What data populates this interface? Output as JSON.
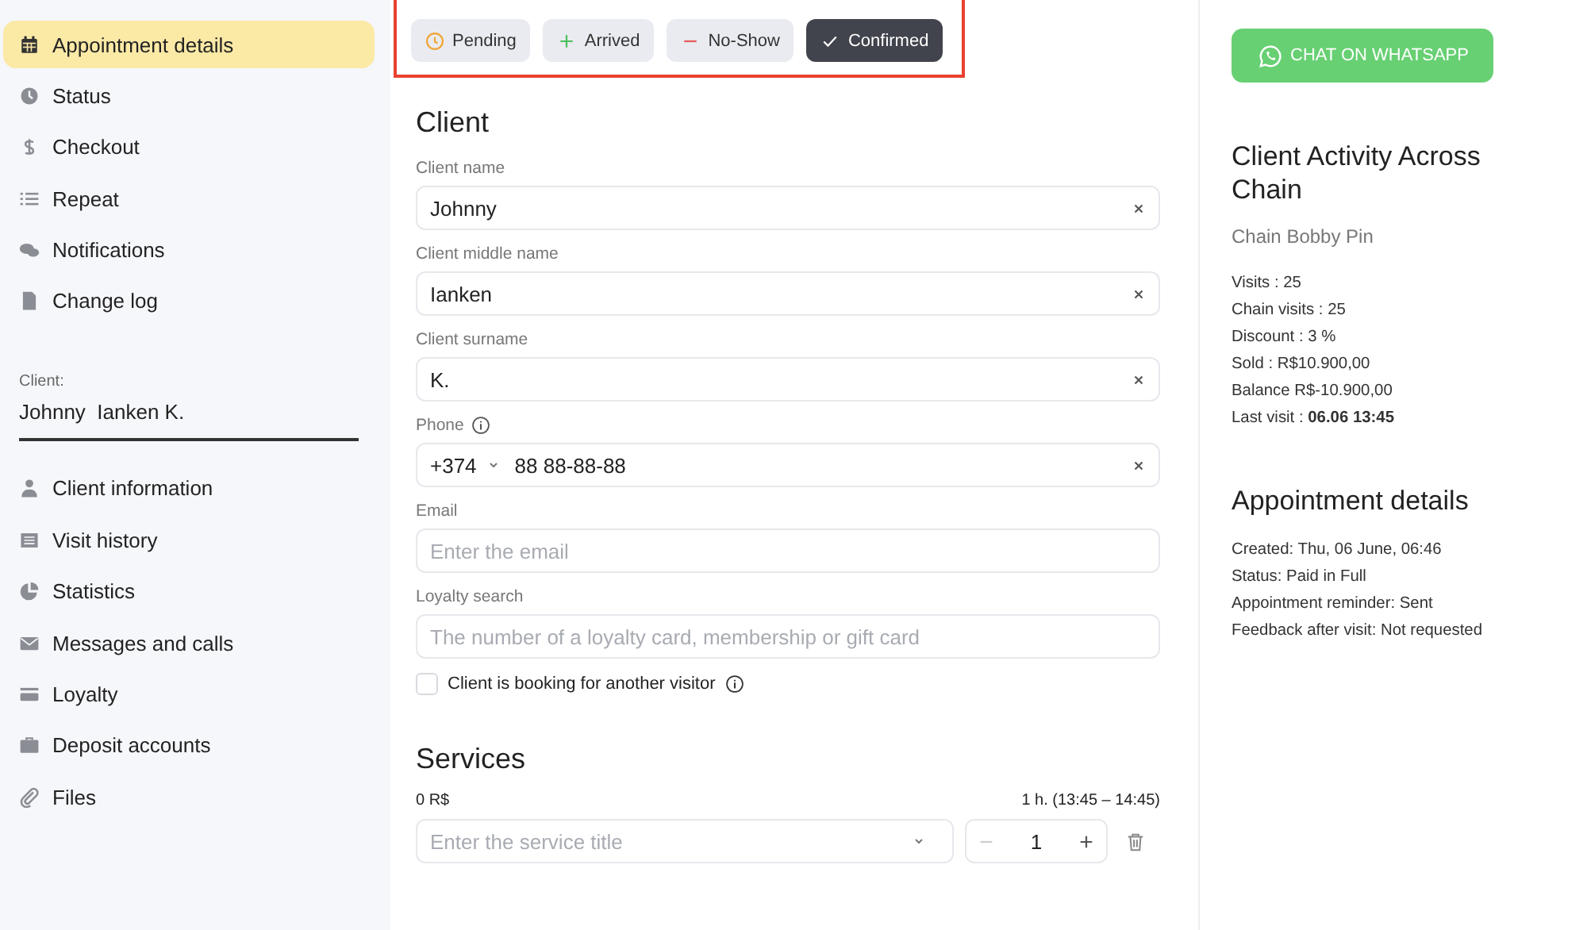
{
  "sidebar": {
    "items": [
      {
        "label": "Appointment details",
        "selected": true
      },
      {
        "label": "Status",
        "selected": false
      },
      {
        "label": "Checkout",
        "selected": false
      },
      {
        "label": "Repeat",
        "selected": false
      },
      {
        "label": "Notifications",
        "selected": false
      },
      {
        "label": "Change log",
        "selected": false
      }
    ],
    "client_label": "Client:",
    "client_name": "Johnny  Ianken K.",
    "client_items": [
      {
        "label": "Client information",
        "selected": false
      },
      {
        "label": "Visit history",
        "selected": false
      },
      {
        "label": "Statistics",
        "selected": false
      },
      {
        "label": "Messages and calls",
        "selected": false
      },
      {
        "label": "Loyalty",
        "selected": false
      },
      {
        "label": "Deposit accounts",
        "selected": false
      },
      {
        "label": "Files",
        "selected": false
      }
    ]
  },
  "status_buttons": [
    {
      "kind": "pending",
      "label": "Pending",
      "selected": false
    },
    {
      "kind": "arrived",
      "label": "Arrived",
      "selected": false
    },
    {
      "kind": "noshow",
      "label": "No-Show",
      "selected": false
    },
    {
      "kind": "confirmed",
      "label": "Confirmed",
      "selected": true
    }
  ],
  "client_section": {
    "title": "Client",
    "fields": [
      {
        "kind": "text",
        "label": "Client name",
        "value": "Johnny"
      },
      {
        "kind": "text",
        "label": "Client middle name",
        "value": "Ianken"
      },
      {
        "kind": "text",
        "label": "Client surname",
        "value": "K."
      },
      {
        "kind": "phone",
        "label": "Phone",
        "code": "+374",
        "value": "88 88-88-88"
      },
      {
        "kind": "text",
        "label": "Email",
        "placeholder": "Enter the email"
      },
      {
        "kind": "text",
        "label": "Loyalty search",
        "placeholder": "The number of a loyalty card, membership or gift card"
      }
    ],
    "another_visitor": {
      "label": "Client is booking for another visitor",
      "checked": false
    }
  },
  "services": {
    "title": "Services",
    "price": "0 R$",
    "duration": "1 h. (13:45 – 14:45)",
    "service_placeholder": "Enter the service title",
    "quantity": "1"
  },
  "whatsapp_button": "CHAT ON WHATSAPP",
  "activity": {
    "title": "Client Activity Across Chain",
    "chain": "Chain Bobby Pin",
    "lines": [
      "Visits : 25",
      "Chain visits : 25",
      "Discount : 3 %",
      "Sold : R$10.900,00",
      "Balance R$-10.900,00",
      "Last visit : **06.06 13:45**"
    ]
  },
  "details": {
    "title": "Appointment details",
    "lines": [
      "Created: Thu, 06 June, 06:46",
      "Status: Paid in Full",
      "Appointment reminder: Sent",
      "Feedback after visit: Not requested"
    ]
  }
}
